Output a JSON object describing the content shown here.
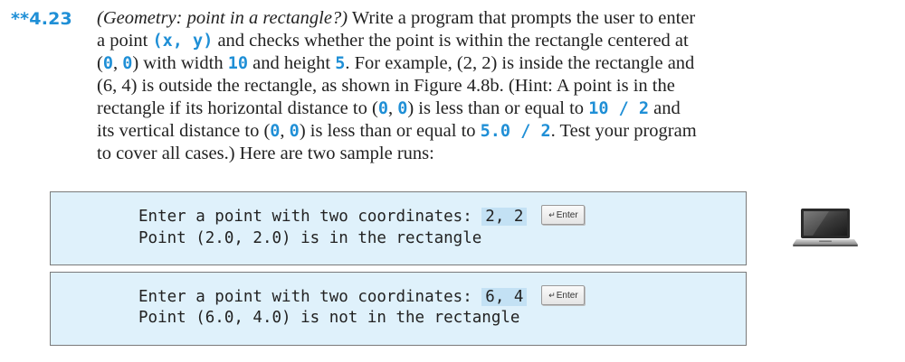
{
  "exercise": {
    "number": "**4.23",
    "lines": [
      {
        "title": "(Geometry: point in a rectangle?)",
        "t1": " Write a program that prompts the user to enter"
      },
      {
        "t1": "a point ",
        "c1": "(x, y)",
        "t2": " and checks whether the point is within the rectangle centered at"
      },
      {
        "t1": "(",
        "c1": "0",
        "t2": ", ",
        "c2": "0",
        "t3": ") with width ",
        "c3": "10",
        "t4": " and height ",
        "c4": "5",
        "t5": ". For example, (2, 2) is inside the rectangle and"
      },
      {
        "t1": "(6, 4) is outside the rectangle, as shown in Figure 4.8b. (Hint: A point is in the"
      },
      {
        "t1": "rectangle if its horizontal distance to (",
        "c1": "0",
        "t2": ", ",
        "c2": "0",
        "t3": ") is less than or equal to ",
        "c3": "10 / 2",
        "t4": " and"
      },
      {
        "t1": "its vertical distance to (",
        "c1": "0",
        "t2": ", ",
        "c2": "0",
        "t3": ") is less than or equal to ",
        "c3": "5.0 / 2",
        "t4": ". Test your program"
      },
      {
        "t1": "to cover all cases.) Here are two sample runs:"
      }
    ]
  },
  "runs": [
    {
      "prompt": "Enter a point with two coordinates: ",
      "input": "2, 2",
      "enter_label": "Enter",
      "output": "Point (2.0, 2.0) is in the rectangle"
    },
    {
      "prompt": "Enter a point with two coordinates: ",
      "input": "6, 4",
      "enter_label": "Enter",
      "output": "Point (6.0, 4.0) is not in the rectangle"
    }
  ],
  "icons": {
    "enter": "return-arrow-icon",
    "laptop": "laptop-icon"
  },
  "colors": {
    "accent": "#1f8fd6",
    "run_background": "#dff1fb",
    "input_highlight": "#c3e1f4"
  }
}
